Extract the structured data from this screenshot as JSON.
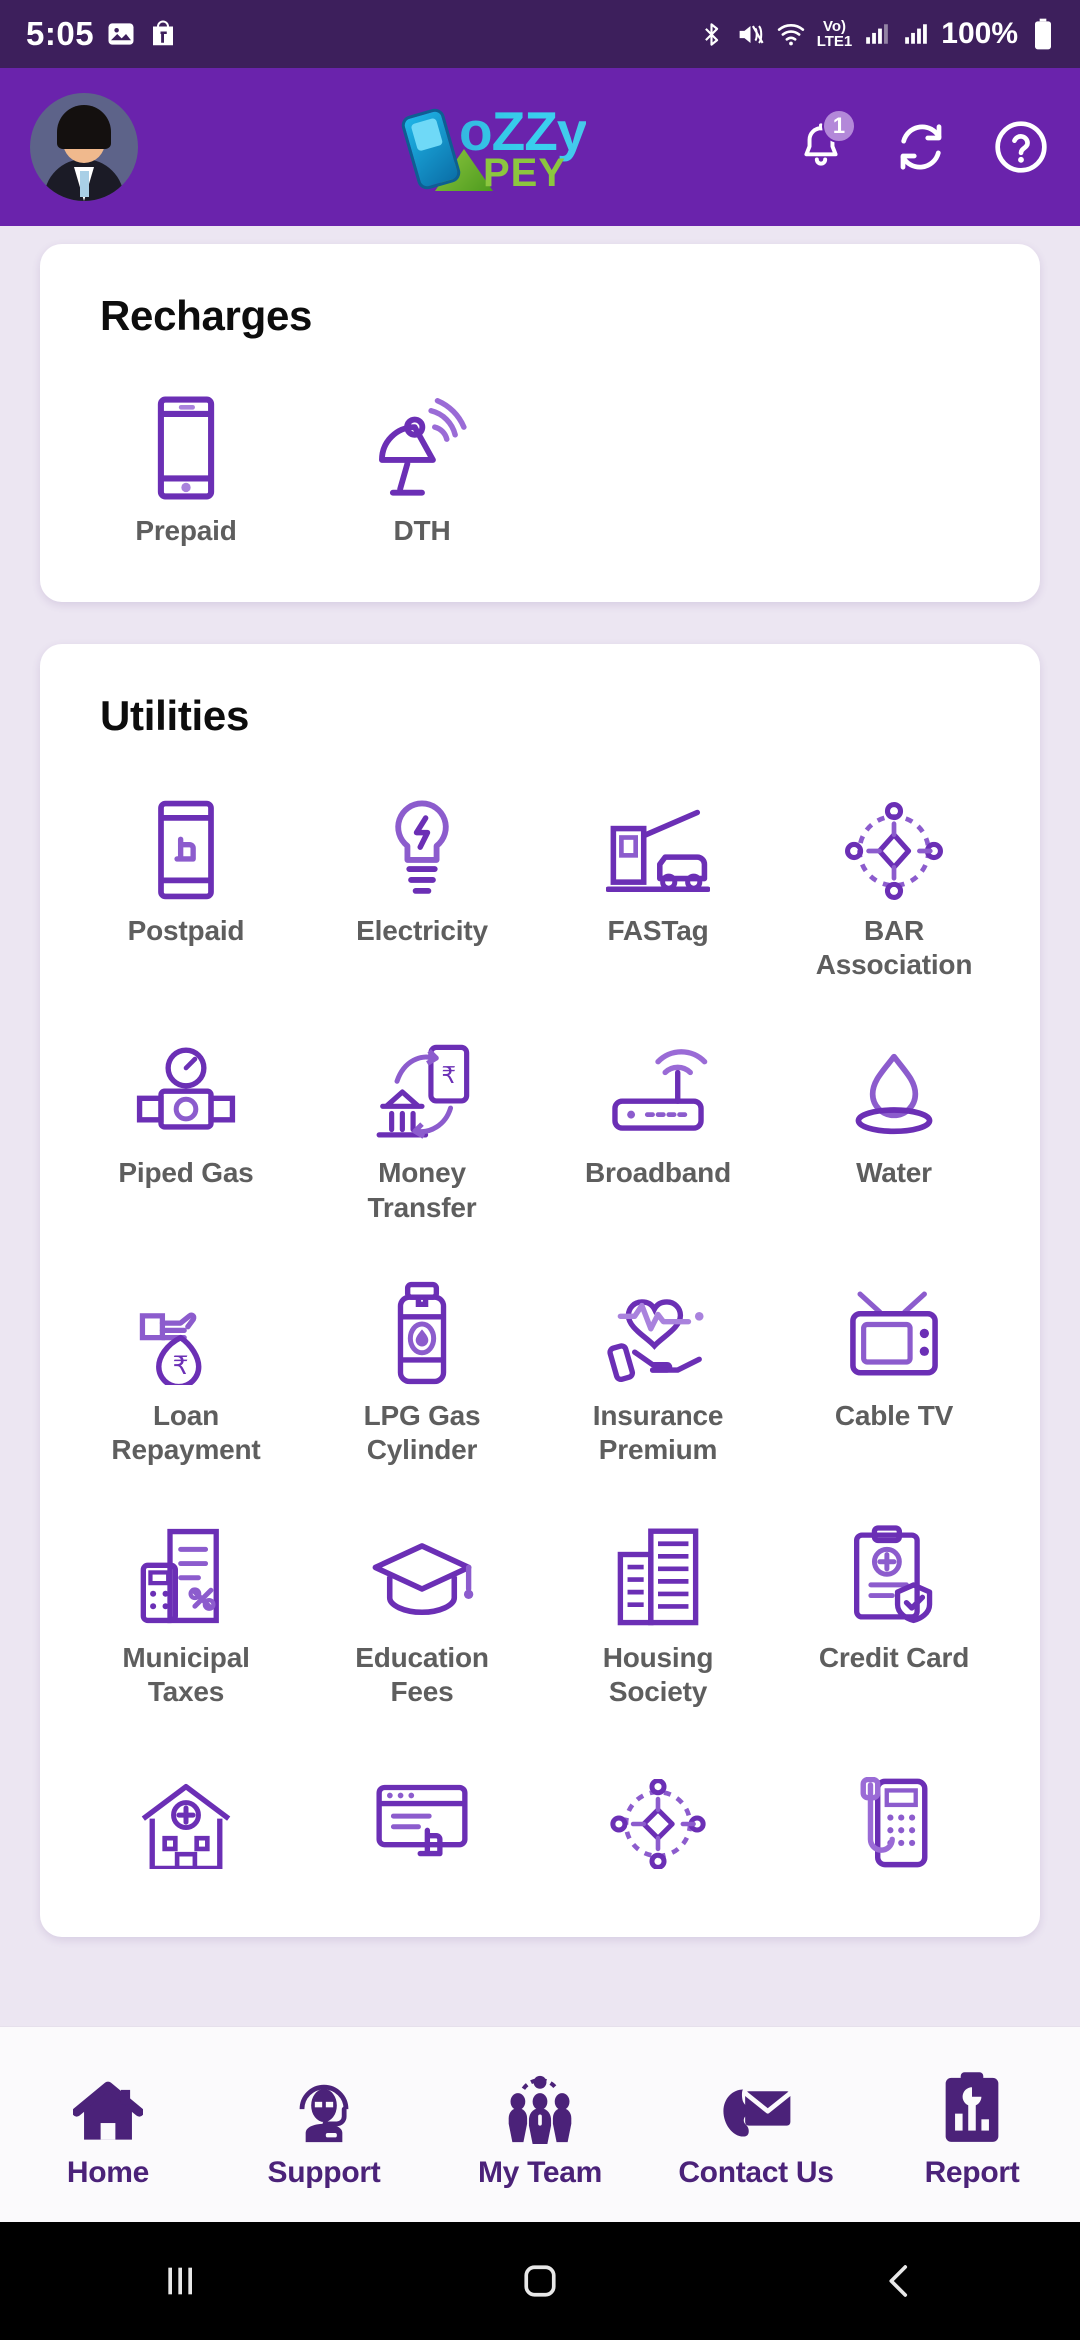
{
  "status_bar": {
    "clock": "5:05",
    "battery_percent": "100%",
    "network_label": "Vo)",
    "network_sub": "LTE1",
    "icons": [
      "photos-icon",
      "flipkart-icon",
      "bluetooth-icon",
      "mute-vibrate-icon",
      "wifi-icon",
      "volte-icon",
      "signal-icon",
      "signal-2-icon",
      "battery-icon"
    ]
  },
  "header": {
    "logo_word": "oZZy",
    "logo_sub": "PEY",
    "avatar_name": "avatar",
    "notification_count": "1",
    "icons": [
      "bell-icon",
      "refresh-icon",
      "help-icon"
    ],
    "background": "#6a23ac"
  },
  "recharges": {
    "title": "Recharges",
    "items": [
      {
        "label": "Prepaid",
        "icon": "mobile-phone-icon"
      },
      {
        "label": "DTH",
        "icon": "satellite-dish-icon"
      }
    ]
  },
  "utilities": {
    "title": "Utilities",
    "items": [
      {
        "label": "Postpaid",
        "icon": "mobile-hand-icon"
      },
      {
        "label": "Electricity",
        "icon": "light-bulb-icon"
      },
      {
        "label": "FASTag",
        "icon": "toll-booth-icon"
      },
      {
        "label": "BAR Association",
        "icon": "network-nodes-icon"
      },
      {
        "label": "Piped Gas",
        "icon": "gas-meter-icon"
      },
      {
        "label": "Money Transfer",
        "icon": "money-transfer-icon"
      },
      {
        "label": "Broadband",
        "icon": "router-icon"
      },
      {
        "label": "Water",
        "icon": "water-drop-icon"
      },
      {
        "label": "Loan Repayment",
        "icon": "money-bag-hand-icon"
      },
      {
        "label": "LPG Gas Cylinder",
        "icon": "gas-cylinder-icon"
      },
      {
        "label": "Insurance Premium",
        "icon": "heart-hand-icon"
      },
      {
        "label": "Cable TV",
        "icon": "television-icon"
      },
      {
        "label": "Municipal Taxes",
        "icon": "tax-invoice-icon"
      },
      {
        "label": "Education Fees",
        "icon": "graduation-cap-icon"
      },
      {
        "label": "Housing Society",
        "icon": "buildings-icon"
      },
      {
        "label": "Credit Card",
        "icon": "credit-clipboard-icon"
      },
      {
        "label": "",
        "icon": "hospital-icon"
      },
      {
        "label": "",
        "icon": "web-click-icon"
      },
      {
        "label": "",
        "icon": "network-nodes-icon"
      },
      {
        "label": "",
        "icon": "landline-phone-icon"
      }
    ]
  },
  "bottom_nav": {
    "items": [
      {
        "label": "Home",
        "icon": "home-icon"
      },
      {
        "label": "Support",
        "icon": "headset-agent-icon"
      },
      {
        "label": "My Team",
        "icon": "team-people-icon"
      },
      {
        "label": "Contact Us",
        "icon": "mail-phone-icon"
      },
      {
        "label": "Report",
        "icon": "report-clipboard-icon"
      }
    ],
    "accent": "#4b2279"
  },
  "system_nav": {
    "items": [
      "recents-icon",
      "home-square-icon",
      "back-icon"
    ]
  }
}
